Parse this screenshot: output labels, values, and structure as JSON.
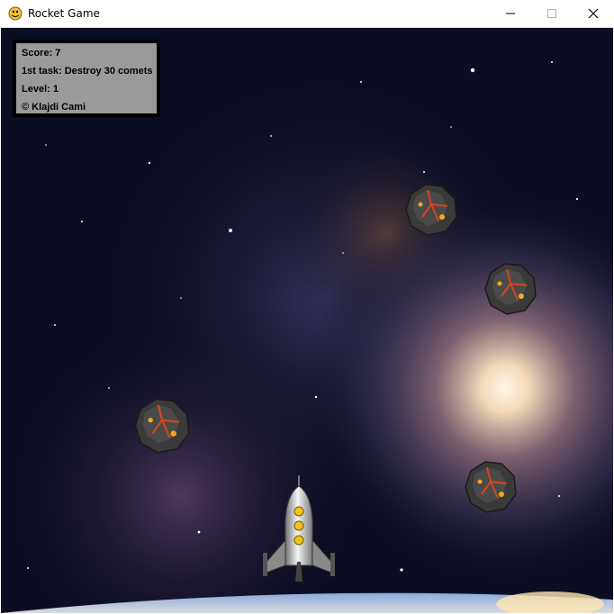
{
  "window": {
    "title": "Rocket Game"
  },
  "hud": {
    "score": "Score: 7",
    "task": "1st task: Destroy 30 comets",
    "level": "Level: 1",
    "credit": "© Klajdi Cami"
  },
  "icons": {
    "app": "python-snake-icon",
    "minimize": "minimize-icon",
    "maximize": "maximize-icon",
    "close": "close-icon"
  },
  "colors": {
    "hud_background": "#9a9a9a",
    "hud_border": "#000000",
    "space": "#0a0c1f",
    "nebula_glow": "#f3d8b8",
    "comet_rock": "#3a3a3a",
    "comet_lava": "#e2451a"
  },
  "sprites": {
    "comets": [
      "comet",
      "comet",
      "comet",
      "comet"
    ],
    "player": "rocket"
  }
}
